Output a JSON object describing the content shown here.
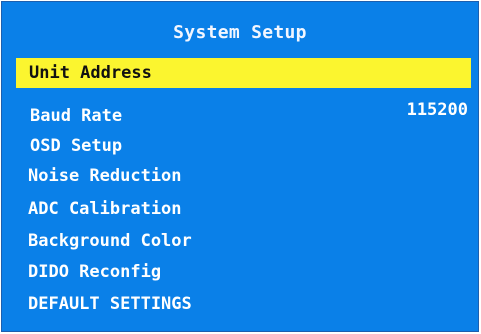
{
  "menu": {
    "title": "System Setup",
    "items": [
      {
        "label": "Unit Address",
        "value": ""
      },
      {
        "label": "Baud Rate",
        "value": "115200"
      },
      {
        "label": "OSD Setup",
        "value": ""
      },
      {
        "label": "Noise Reduction",
        "value": ""
      },
      {
        "label": "ADC Calibration",
        "value": ""
      },
      {
        "label": "Background Color",
        "value": ""
      },
      {
        "label": "DIDO Reconfig",
        "value": ""
      },
      {
        "label": "DEFAULT SETTINGS",
        "value": ""
      }
    ],
    "selected_index": 0
  },
  "colors": {
    "background": "#0a80e8",
    "highlight": "#fbf52f",
    "text": "#ffffff",
    "selected_text": "#111111"
  }
}
